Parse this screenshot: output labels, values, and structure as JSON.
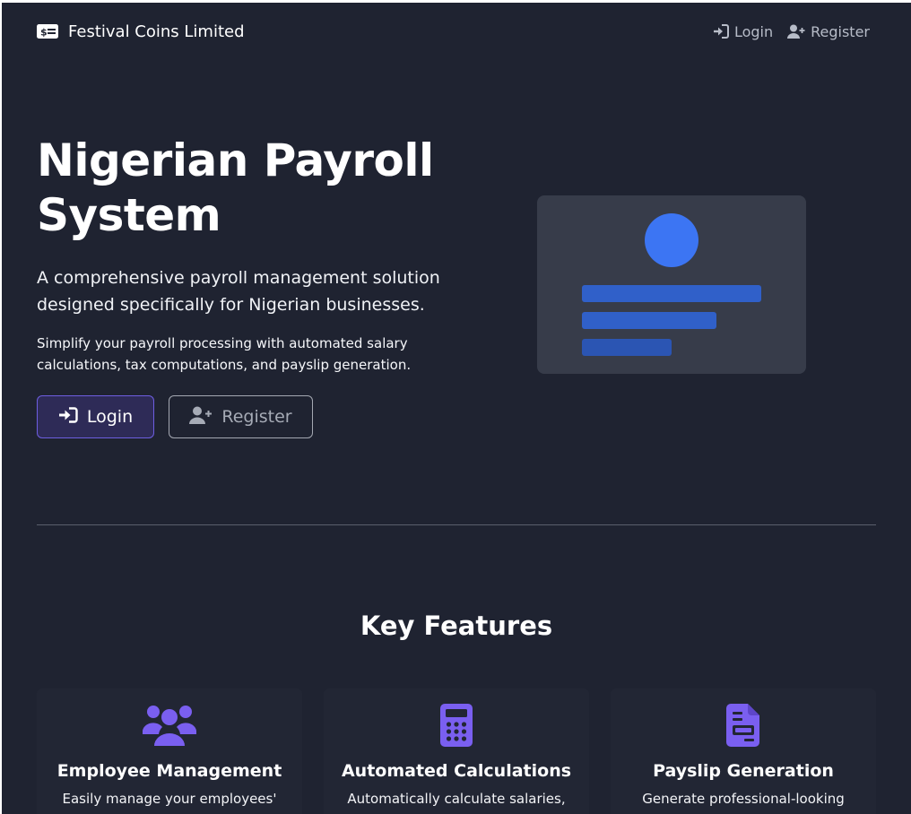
{
  "navbar": {
    "brand": "Festival Coins Limited",
    "brand_icon": "money-bill-icon",
    "links": [
      {
        "label": "Login",
        "icon": "sign-in-icon"
      },
      {
        "label": "Register",
        "icon": "user-plus-icon"
      }
    ]
  },
  "hero": {
    "title": "Nigerian Payroll System",
    "lead": "A comprehensive payroll management solution designed specifically for Nigerian businesses.",
    "description": "Simplify your payroll processing with automated salary calculations, tax computations, and payslip generation.",
    "login_button": "Login",
    "register_button": "Register"
  },
  "features": {
    "title": "Key Features",
    "items": [
      {
        "icon": "users-icon",
        "name": "Employee Management",
        "description": "Easily manage your employees'"
      },
      {
        "icon": "calculator-icon",
        "name": "Automated Calculations",
        "description": "Automatically calculate salaries,"
      },
      {
        "icon": "file-invoice-icon",
        "name": "Payslip Generation",
        "description": "Generate professional-looking"
      }
    ]
  },
  "colors": {
    "background": "#1f2331",
    "accent": "#6d5ee0",
    "illustration_blue": "#3c75f3",
    "card": "#373c4a"
  }
}
